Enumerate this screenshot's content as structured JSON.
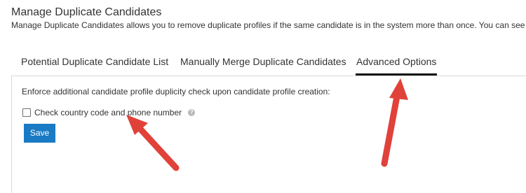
{
  "header": {
    "title": "Manage Duplicate Candidates",
    "description": "Manage Duplicate Candidates allows you to remove duplicate profiles if the same candidate is in the system more than once. You can see a list of"
  },
  "tabs": [
    {
      "label": "Potential Duplicate Candidate List",
      "active": false
    },
    {
      "label": "Manually Merge Duplicate Candidates",
      "active": false
    },
    {
      "label": "Advanced Options",
      "active": true
    }
  ],
  "panel": {
    "enforce_label": "Enforce additional candidate profile duplicity check upon candidate profile creation:",
    "option_label": "Check country code and phone number",
    "option_checked": false,
    "help_icon": "question-circle-icon",
    "save_label": "Save"
  },
  "annotations": {
    "arrow_color": "#e0423a",
    "arrows": [
      "annotation-arrow-checkbox",
      "annotation-arrow-tab"
    ]
  },
  "colors": {
    "accent": "#1a7ac4",
    "active_tab_underline": "#111111",
    "annotation": "#e0423a"
  }
}
